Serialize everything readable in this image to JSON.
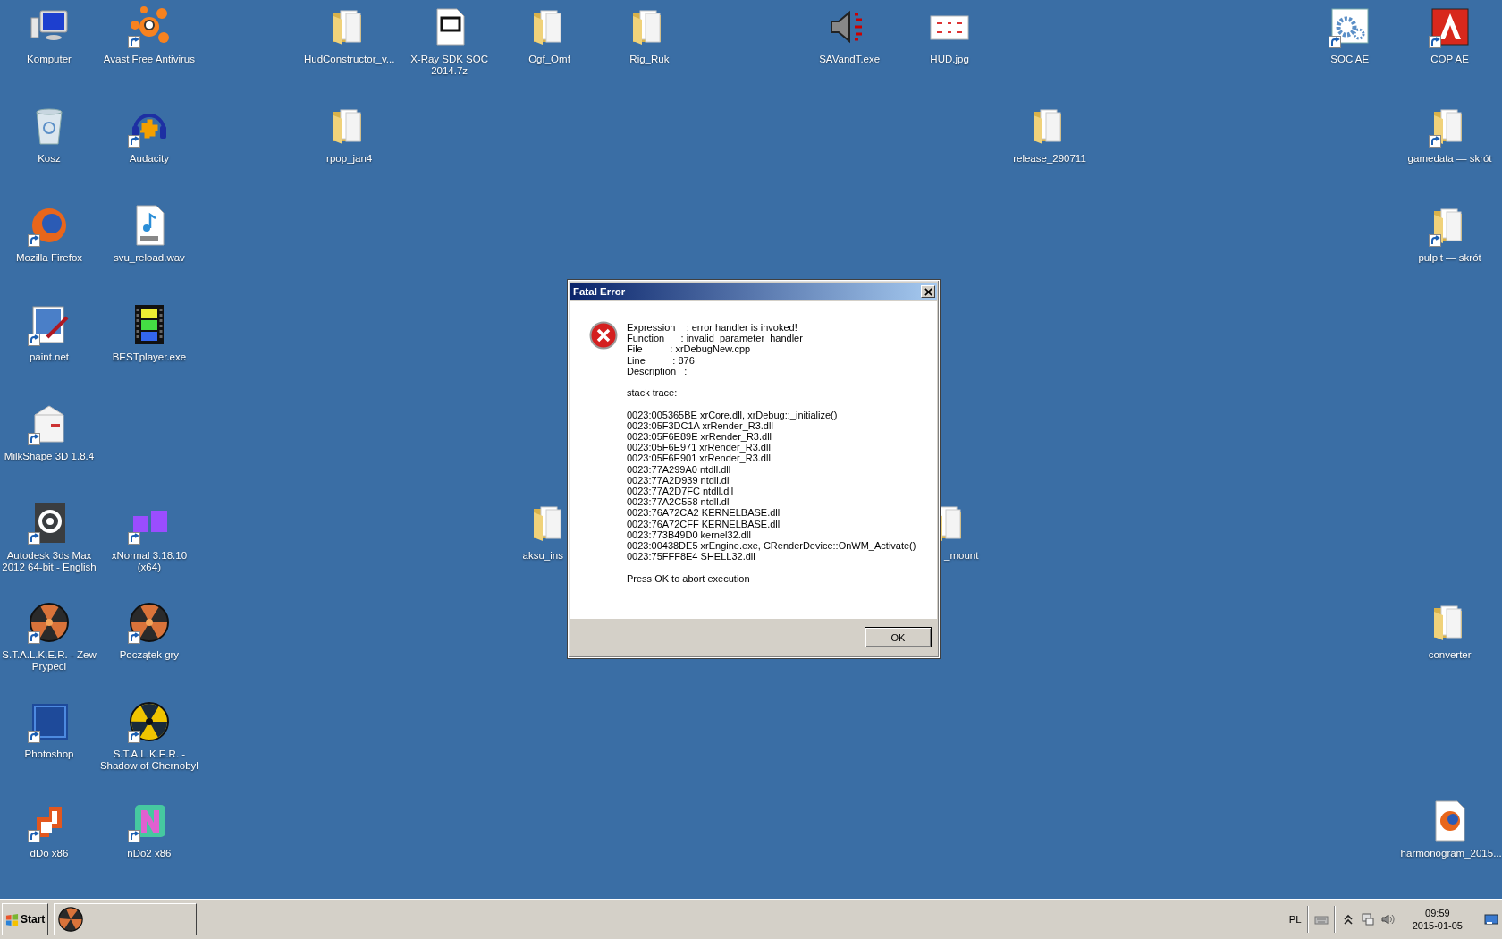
{
  "desktop_icons": [
    {
      "label": "Komputer",
      "kind": "computer",
      "shortcut": false
    },
    {
      "label": "Avast Free Antivirus",
      "kind": "avast",
      "shortcut": true
    },
    {
      "label": "HudConstructor_v...",
      "kind": "folder",
      "shortcut": false
    },
    {
      "label": "X-Ray SDK SOC 2014.7z",
      "kind": "archive",
      "shortcut": false
    },
    {
      "label": "Ogf_Omf",
      "kind": "folder",
      "shortcut": false
    },
    {
      "label": "Rig_Ruk",
      "kind": "folder",
      "shortcut": false
    },
    {
      "label": "SAVandT.exe",
      "kind": "speaker",
      "shortcut": false
    },
    {
      "label": "HUD.jpg",
      "kind": "image",
      "shortcut": false
    },
    {
      "label": "SOC AE",
      "kind": "gear",
      "shortcut": true
    },
    {
      "label": "COP AE",
      "kind": "cop",
      "shortcut": true
    },
    {
      "label": "Kosz",
      "kind": "trash",
      "shortcut": false
    },
    {
      "label": "Audacity",
      "kind": "audacity",
      "shortcut": true
    },
    {
      "label": "rpop_jan4",
      "kind": "folder",
      "shortcut": false
    },
    {
      "label": "release_290711",
      "kind": "folder",
      "shortcut": false
    },
    {
      "label": "gamedata — skrót",
      "kind": "folder",
      "shortcut": true
    },
    {
      "label": "Mozilla Firefox",
      "kind": "firefox",
      "shortcut": true
    },
    {
      "label": "svu_reload.wav",
      "kind": "audio",
      "shortcut": false
    },
    {
      "label": "pulpit — skrót",
      "kind": "folder",
      "shortcut": true
    },
    {
      "label": "paint.net",
      "kind": "paint",
      "shortcut": true
    },
    {
      "label": "BESTplayer.exe",
      "kind": "film",
      "shortcut": false
    },
    {
      "label": "MilkShape 3D 1.8.4",
      "kind": "carton",
      "shortcut": true
    },
    {
      "label": "Autodesk 3ds Max 2012 64-bit - English",
      "kind": "max",
      "shortcut": true
    },
    {
      "label": "xNormal 3.18.10 (x64)",
      "kind": "xnormal",
      "shortcut": true
    },
    {
      "label": "aksu_ins",
      "kind": "folder",
      "shortcut": false
    },
    {
      "label": "_mount",
      "kind": "folder",
      "shortcut": false
    },
    {
      "label": "S.T.A.L.K.E.R. - Zew Prypeci",
      "kind": "radiation",
      "shortcut": true
    },
    {
      "label": "Początek gry",
      "kind": "radiation",
      "shortcut": true
    },
    {
      "label": "converter",
      "kind": "folder",
      "shortcut": false
    },
    {
      "label": "Photoshop",
      "kind": "photoshop",
      "shortcut": true
    },
    {
      "label": "S.T.A.L.K.E.R. - Shadow of Chernobyl",
      "kind": "radiation-yellow",
      "shortcut": true
    },
    {
      "label": "dDo x86",
      "kind": "ddo",
      "shortcut": true
    },
    {
      "label": "nDo2 x86",
      "kind": "ndo",
      "shortcut": true
    },
    {
      "label": "harmonogram_2015...",
      "kind": "webfile",
      "shortcut": false
    }
  ],
  "dialog": {
    "title": "Fatal Error",
    "message": [
      [
        "Expression    : error handler is invoked!",
        "Function      : invalid_parameter_handler",
        "File          : xrDebugNew.cpp",
        "Line          : 876",
        "Description   :"
      ],
      [
        "stack trace:"
      ],
      [
        "0023:005365BE xrCore.dll, xrDebug::_initialize()",
        "0023:05F3DC1A xrRender_R3.dll",
        "0023:05F6E89E xrRender_R3.dll",
        "0023:05F6E971 xrRender_R3.dll",
        "0023:05F6E901 xrRender_R3.dll",
        "0023:77A299A0 ntdll.dll",
        "0023:77A2D939 ntdll.dll",
        "0023:77A2D7FC ntdll.dll",
        "0023:77A2C558 ntdll.dll",
        "0023:76A72CA2 KERNELBASE.dll",
        "0023:76A72CFF KERNELBASE.dll",
        "0023:773B49D0 kernel32.dll",
        "0023:00438DE5 xrEngine.exe, CRenderDevice::OnWM_Activate()",
        "0023:75FFF8E4 SHELL32.dll"
      ],
      [
        "Press OK to abort execution"
      ]
    ],
    "button": "OK"
  },
  "taskbar": {
    "start": "Start",
    "language": "PL",
    "time": "09:59",
    "date": "2015-01-05"
  }
}
